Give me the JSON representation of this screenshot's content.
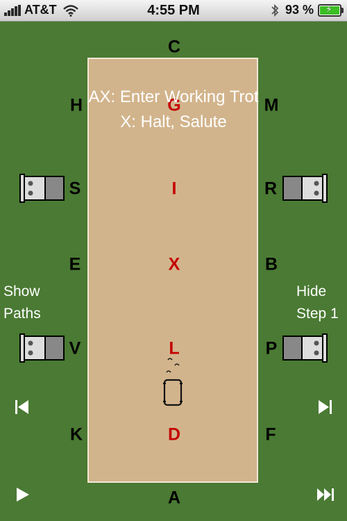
{
  "status": {
    "carrier": "AT&T",
    "time": "4:55 PM",
    "battery": "93 %",
    "battery_level": 0.93,
    "icons": [
      "signal-bars-icon",
      "wifi-icon",
      "bluetooth-icon",
      "battery-charging-icon"
    ]
  },
  "arena": {
    "outer_letters": {
      "C": "C",
      "H": "H",
      "M": "M",
      "S": "S",
      "R": "R",
      "E": "E",
      "B": "B",
      "V": "V",
      "P": "P",
      "K": "K",
      "F": "F",
      "A": "A"
    },
    "center_letters": {
      "G": "G",
      "I": "I",
      "X": "X",
      "L": "L",
      "D": "D"
    }
  },
  "instructions": {
    "line1": "AX: Enter Working Trot",
    "line2": "X: Halt, Salute"
  },
  "controls": {
    "show_paths_line1": "Show",
    "show_paths_line2": "Paths",
    "hide_step_line1": "Hide",
    "hide_step_line2": "Step 1",
    "icons": [
      "skip-back-icon",
      "skip-forward-icon",
      "play-icon",
      "fast-forward-icon"
    ]
  },
  "colors": {
    "grass": "#4a7a33",
    "arena": "#d2b48c",
    "center_letter": "#c40000",
    "text": "#ffffff"
  }
}
